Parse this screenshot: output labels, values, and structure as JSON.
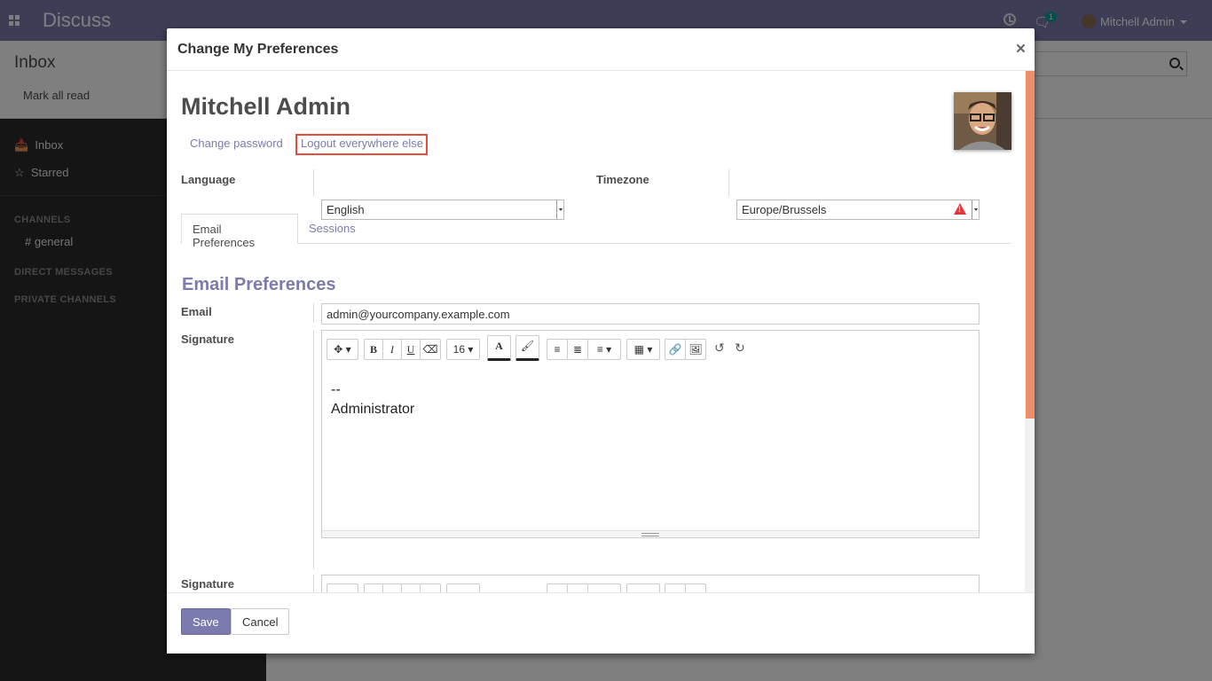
{
  "app": {
    "title": "Discuss",
    "user_name": "Mitchell Admin",
    "chat_count": "1"
  },
  "control_panel": {
    "title": "Inbox",
    "mark_all_read": "Mark all read"
  },
  "sidebar": {
    "inbox": "Inbox",
    "starred": "Starred",
    "channels_header": "CHANNELS",
    "channel_general": "# general",
    "direct_messages_header": "DIRECT MESSAGES",
    "private_channels_header": "PRIVATE CHANNELS"
  },
  "modal": {
    "title": "Change My Preferences",
    "close": "×",
    "user_name": "Mitchell Admin",
    "change_password": "Change password",
    "logout_elsewhere": "Logout everywhere else",
    "language_label": "Language",
    "language_value": "English",
    "timezone_label": "Timezone",
    "timezone_value": "Europe/Brussels",
    "tabs": [
      "Email Preferences",
      "Sessions"
    ],
    "section_title": "Email Preferences",
    "email_label": "Email",
    "email_value": "admin@yourcompany.example.com",
    "signature_label": "Signature",
    "signature_label_2": "Signature",
    "signature_lines": [
      "--",
      "Administrator"
    ],
    "font_size": "16",
    "save": "Save",
    "cancel": "Cancel"
  },
  "colors": {
    "brand": "#7c7bad",
    "highlight_box": "#e74c3c",
    "scrollbar": "#ec8e6a",
    "warning": "#e0353b"
  }
}
